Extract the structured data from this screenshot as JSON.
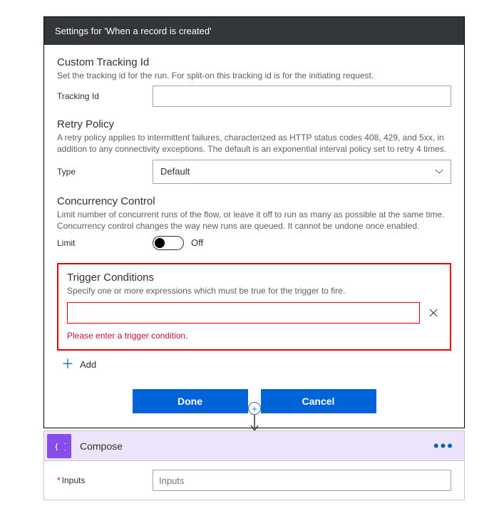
{
  "settings": {
    "header": "Settings for 'When a record is created'",
    "tracking": {
      "title": "Custom Tracking Id",
      "desc": "Set the tracking id for the run. For split-on this tracking id is for the initiating request.",
      "label": "Tracking Id",
      "value": ""
    },
    "retry": {
      "title": "Retry Policy",
      "desc": "A retry policy applies to intermittent failures, characterized as HTTP status codes 408, 429, and 5xx, in addition to any connectivity exceptions. The default is an exponential interval policy set to retry 4 times.",
      "label": "Type",
      "selected": "Default"
    },
    "concurrency": {
      "title": "Concurrency Control",
      "desc": "Limit number of concurrent runs of the flow, or leave it off to run as many as possible at the same time. Concurrency control changes the way new runs are queued. It cannot be undone once enabled.",
      "label": "Limit",
      "state": "Off"
    },
    "trigger": {
      "title": "Trigger Conditions",
      "desc": "Specify one or more expressions which must be true for the trigger to fire.",
      "expression": "",
      "error": "Please enter a trigger condition."
    },
    "add_label": "Add",
    "buttons": {
      "done": "Done",
      "cancel": "Cancel"
    }
  },
  "compose": {
    "title": "Compose",
    "input_label": "Inputs",
    "input_placeholder": "Inputs"
  }
}
